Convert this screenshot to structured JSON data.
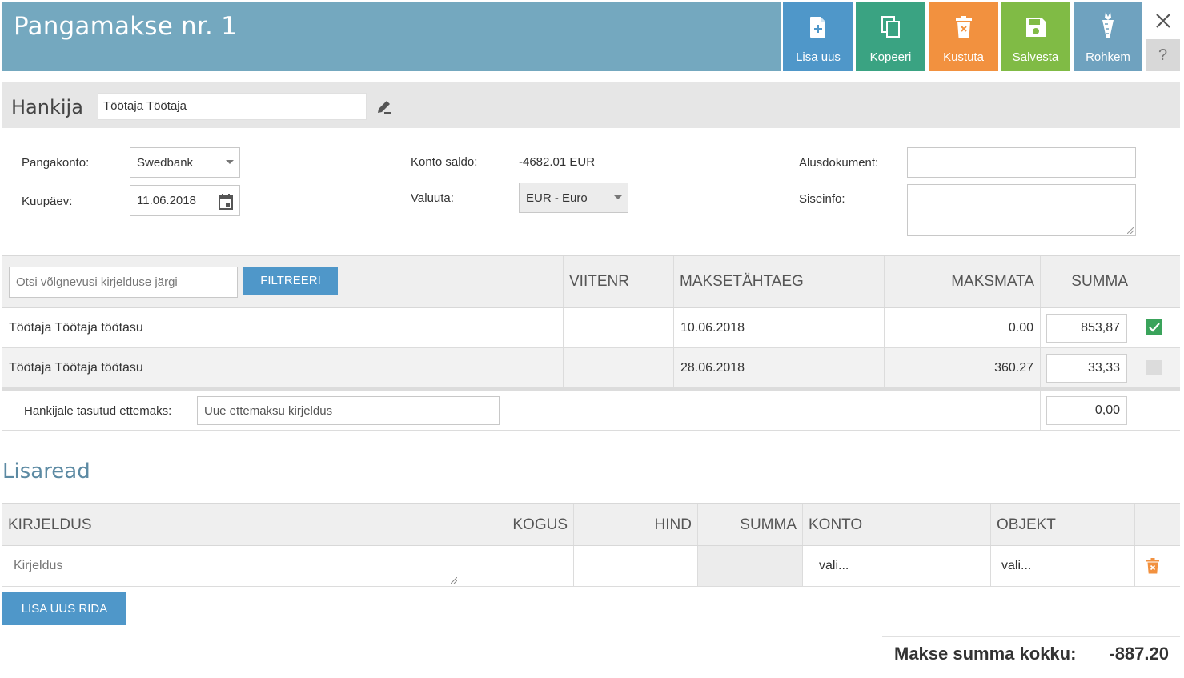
{
  "header": {
    "title": "Pangamakse nr. 1",
    "buttons": {
      "add": "Lisa uus",
      "copy": "Kopeeri",
      "delete": "Kustuta",
      "save": "Salvesta",
      "more": "Rohkem"
    },
    "help": "?"
  },
  "supplier": {
    "label": "Hankija",
    "value": "Töötaja Töötaja"
  },
  "form": {
    "bank_account_label": "Pangakonto:",
    "bank_account_value": "Swedbank",
    "date_label": "Kuupäev:",
    "date_value": "11.06.2018",
    "balance_label": "Konto saldo:",
    "balance_value": "-4682.01 EUR",
    "currency_label": "Valuuta:",
    "currency_value": "EUR - Euro",
    "base_doc_label": "Alusdokument:",
    "base_doc_value": "",
    "internal_label": "Siseinfo:",
    "internal_value": ""
  },
  "debts": {
    "search_placeholder": "Otsi võlgnevusi kirjelduse järgi",
    "filter_label": "FILTREERI",
    "columns": {
      "ref": "VIITENR",
      "due": "MAKSETÄHTAEG",
      "unpaid": "MAKSMATA",
      "sum": "SUMMA"
    },
    "rows": [
      {
        "desc": "Töötaja Töötaja töötasu",
        "ref": "",
        "due": "10.06.2018",
        "unpaid": "0.00",
        "sum": "853,87",
        "checked": true
      },
      {
        "desc": "Töötaja Töötaja töötasu",
        "ref": "",
        "due": "28.06.2018",
        "unpaid": "360.27",
        "sum": "33,33",
        "checked": false
      }
    ],
    "prepayment_label": "Hankijale tasutud ettemaks:",
    "prepayment_placeholder": "Uue ettemaksu kirjeldus",
    "prepayment_sum": "0,00"
  },
  "extra": {
    "title": "Lisaread",
    "columns": {
      "desc": "KIRJELDUS",
      "qty": "KOGUS",
      "price": "HIND",
      "sum": "SUMMA",
      "account": "KONTO",
      "object": "OBJEKT"
    },
    "row": {
      "desc_placeholder": "Kirjeldus",
      "account": "vali...",
      "object": "vali..."
    },
    "add_row_label": "LISA UUS RIDA"
  },
  "total": {
    "label": "Makse summa kokku:",
    "value": "-887.20"
  },
  "colors": {
    "header": "#74a8bf",
    "add": "#4f97c9",
    "copy": "#3aa382",
    "delete": "#f2913f",
    "save": "#80bb45",
    "more": "#6fa2bf",
    "check": "#3aa35b"
  }
}
